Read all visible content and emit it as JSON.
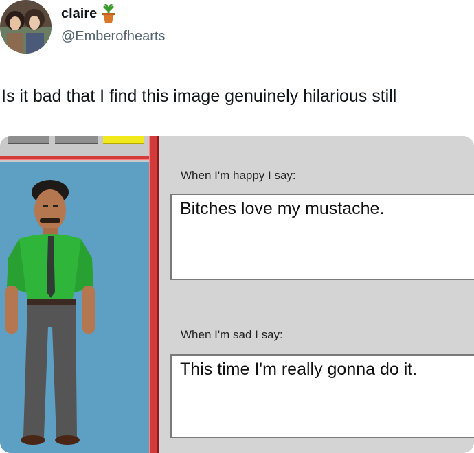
{
  "tweet": {
    "display_name": "claire",
    "name_emoji_icon": "potted-plant-icon",
    "handle": "@Emberofhearts",
    "text": "Is it bad that I find this image genuinely hilarious still"
  },
  "media": {
    "happy_prompt": "When I'm happy I say:",
    "happy_answer": "Bitches love my mustache.",
    "sad_prompt": "When I'm sad I say:",
    "sad_answer": "This time I'm really gonna do it.",
    "colors": {
      "panel_gray": "#d4d4d4",
      "frame_red": "#d33a3a",
      "portrait_blue": "#5e9fc4",
      "shirt_green": "#2fb53a",
      "pants_gray": "#555555",
      "button_yellow": "#f1e91a"
    }
  }
}
